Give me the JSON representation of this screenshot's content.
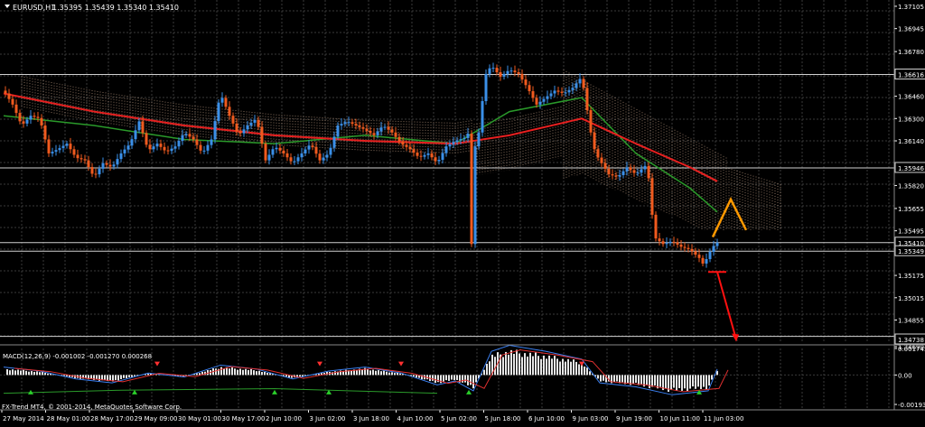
{
  "header": {
    "symbol": "EURUSD,H1",
    "ohlc": "1.35395 1.35439 1.35340 1.35410",
    "menu_arrow": "triangle-down-icon"
  },
  "price_axis": {
    "labels": [
      "1.37105",
      "1.36945",
      "1.36780",
      "1.36616",
      "1.36460",
      "1.36300",
      "1.36140",
      "1.35946",
      "1.35820",
      "1.35655",
      "1.35495",
      "1.35410",
      "1.35349",
      "1.35175",
      "1.35015",
      "1.34855",
      "1.34738",
      "1.34690"
    ],
    "highlighted": [
      "1.36616",
      "1.35946",
      "1.35410",
      "1.35349",
      "1.34738"
    ]
  },
  "macd": {
    "label": "MACD(12,26,9) -0.001002 -0.001270 0.000268",
    "axis_labels": [
      "0.001745",
      "0.00",
      "-0.001935"
    ]
  },
  "footer": {
    "copyright": "FX-Trend MT4, © 2001-2014, MetaQuotes Software Corp."
  },
  "time_axis": {
    "labels": [
      "27 May 2014",
      "28 May 01:00",
      "28 May 17:00",
      "29 May 09:00",
      "30 May 01:00",
      "30 May 17:00",
      "2 Jun 10:00",
      "3 Jun 02:00",
      "3 Jun 18:00",
      "4 Jun 10:00",
      "5 Jun 02:00",
      "5 Jun 18:00",
      "6 Jun 10:00",
      "9 Jun 03:00",
      "9 Jun 19:00",
      "10 Jun 11:00",
      "11 Jun 03:00"
    ]
  },
  "colors": {
    "background": "#000000",
    "grid": "#3a3a3a",
    "bull": "#3a8fe8",
    "bear": "#f05a1e",
    "ma_red": "#e82020",
    "ma_green": "#2a9a2a",
    "cloud": "#f4c8a8",
    "forecast_orange": "#ff9900",
    "forecast_red": "#ff1010",
    "axis_text": "#ffffff",
    "macd_bar": "#e6e6e6"
  },
  "chart_data": {
    "type": "candlestick",
    "symbol": "EURUSD",
    "timeframe": "H1",
    "ylim": [
      1.3469,
      1.3715
    ],
    "last_ohlc": {
      "open": 1.35395,
      "high": 1.35439,
      "low": 1.3534,
      "close": 1.3541
    },
    "horizontal_levels": [
      1.36616,
      1.35946,
      1.3541,
      1.35349,
      1.34738
    ],
    "price_path": [
      [
        0,
        1.365
      ],
      [
        10,
        1.364
      ],
      [
        20,
        1.3625
      ],
      [
        30,
        1.3632
      ],
      [
        40,
        1.363
      ],
      [
        50,
        1.3605
      ],
      [
        60,
        1.3608
      ],
      [
        70,
        1.3612
      ],
      [
        80,
        1.3602
      ],
      [
        90,
        1.36
      ],
      [
        100,
        1.3588
      ],
      [
        110,
        1.3598
      ],
      [
        120,
        1.3595
      ],
      [
        130,
        1.3605
      ],
      [
        140,
        1.3612
      ],
      [
        150,
        1.3628
      ],
      [
        160,
        1.3607
      ],
      [
        170,
        1.3612
      ],
      [
        180,
        1.3606
      ],
      [
        190,
        1.361
      ],
      [
        200,
        1.362
      ],
      [
        210,
        1.3615
      ],
      [
        220,
        1.3605
      ],
      [
        230,
        1.3615
      ],
      [
        240,
        1.3648
      ],
      [
        250,
        1.3632
      ],
      [
        260,
        1.3618
      ],
      [
        270,
        1.3625
      ],
      [
        280,
        1.363
      ],
      [
        290,
        1.36
      ],
      [
        300,
        1.361
      ],
      [
        310,
        1.3605
      ],
      [
        320,
        1.3598
      ],
      [
        330,
        1.3605
      ],
      [
        340,
        1.3612
      ],
      [
        350,
        1.36
      ],
      [
        360,
        1.3605
      ],
      [
        370,
        1.3625
      ],
      [
        380,
        1.3628
      ],
      [
        390,
        1.3625
      ],
      [
        400,
        1.3622
      ],
      [
        410,
        1.3618
      ],
      [
        420,
        1.3625
      ],
      [
        430,
        1.362
      ],
      [
        440,
        1.3612
      ],
      [
        450,
        1.3608
      ],
      [
        460,
        1.3602
      ],
      [
        470,
        1.3605
      ],
      [
        480,
        1.3598
      ],
      [
        490,
        1.361
      ],
      [
        500,
        1.3614
      ],
      [
        510,
        1.3616
      ],
      [
        515,
        1.362
      ],
      [
        518,
        1.354
      ],
      [
        522,
        1.361
      ],
      [
        528,
        1.3625
      ],
      [
        532,
        1.366
      ],
      [
        540,
        1.3668
      ],
      [
        550,
        1.366
      ],
      [
        560,
        1.3665
      ],
      [
        570,
        1.3662
      ],
      [
        580,
        1.3652
      ],
      [
        590,
        1.364
      ],
      [
        600,
        1.3645
      ],
      [
        610,
        1.365
      ],
      [
        620,
        1.3648
      ],
      [
        630,
        1.3652
      ],
      [
        640,
        1.366
      ],
      [
        645,
        1.364
      ],
      [
        650,
        1.362
      ],
      [
        655,
        1.3605
      ],
      [
        660,
        1.36
      ],
      [
        670,
        1.359
      ],
      [
        680,
        1.3588
      ],
      [
        690,
        1.3595
      ],
      [
        700,
        1.359
      ],
      [
        710,
        1.3596
      ],
      [
        715,
        1.3585
      ],
      [
        720,
        1.3545
      ],
      [
        730,
        1.354
      ],
      [
        740,
        1.3542
      ],
      [
        750,
        1.3538
      ],
      [
        760,
        1.3536
      ],
      [
        770,
        1.353
      ],
      [
        775,
        1.3525
      ],
      [
        780,
        1.3532
      ],
      [
        785,
        1.3538
      ],
      [
        790,
        1.3541
      ]
    ],
    "ma_slow_red": [
      [
        0,
        1.3648
      ],
      [
        100,
        1.3635
      ],
      [
        200,
        1.3625
      ],
      [
        300,
        1.3618
      ],
      [
        400,
        1.3614
      ],
      [
        500,
        1.3612
      ],
      [
        560,
        1.3618
      ],
      [
        640,
        1.363
      ],
      [
        700,
        1.3612
      ],
      [
        760,
        1.3595
      ],
      [
        790,
        1.3585
      ]
    ],
    "ma_fast_green": [
      [
        0,
        1.3632
      ],
      [
        100,
        1.3625
      ],
      [
        200,
        1.3615
      ],
      [
        300,
        1.3612
      ],
      [
        400,
        1.3618
      ],
      [
        500,
        1.3612
      ],
      [
        560,
        1.3635
      ],
      [
        640,
        1.3645
      ],
      [
        700,
        1.3605
      ],
      [
        760,
        1.358
      ],
      [
        790,
        1.3563
      ]
    ],
    "forecast_orange": [
      [
        785,
        1.3545
      ],
      [
        805,
        1.3572
      ],
      [
        822,
        1.355
      ]
    ],
    "forecast_red": [
      [
        790,
        1.352
      ],
      [
        810,
        1.347
      ]
    ],
    "time_labels": [
      "27 May 2014",
      "28 May 01:00",
      "28 May 17:00",
      "29 May 09:00",
      "30 May 01:00",
      "30 May 17:00",
      "2 Jun 10:00",
      "3 Jun 02:00",
      "3 Jun 18:00",
      "4 Jun 10:00",
      "5 Jun 02:00",
      "5 Jun 18:00",
      "6 Jun 10:00",
      "9 Jun 03:00",
      "9 Jun 19:00",
      "10 Jun 11:00",
      "11 Jun 03:00"
    ],
    "macd": {
      "fast": 12,
      "slow": 26,
      "signal": 9,
      "value": -0.001002,
      "signal_value": -0.00127,
      "histogram": 0.000268,
      "ylim": [
        -0.001935,
        0.001745
      ],
      "histogram_series": [
        [
          0,
          0.0004
        ],
        [
          40,
          0.0002
        ],
        [
          80,
          -0.0002
        ],
        [
          120,
          -0.0004
        ],
        [
          160,
          0.0001
        ],
        [
          200,
          -0.0001
        ],
        [
          240,
          0.0005
        ],
        [
          280,
          0.0003
        ],
        [
          320,
          -0.0002
        ],
        [
          360,
          0.0002
        ],
        [
          400,
          0.0004
        ],
        [
          440,
          0.0001
        ],
        [
          480,
          -0.0005
        ],
        [
          500,
          -0.0003
        ],
        [
          520,
          -0.0008
        ],
        [
          540,
          0.0012
        ],
        [
          560,
          0.0015
        ],
        [
          600,
          0.0012
        ],
        [
          640,
          0.0008
        ],
        [
          660,
          -0.0004
        ],
        [
          700,
          -0.0006
        ],
        [
          740,
          -0.001
        ],
        [
          780,
          -0.0008
        ],
        [
          790,
          0.0003
        ]
      ]
    }
  }
}
